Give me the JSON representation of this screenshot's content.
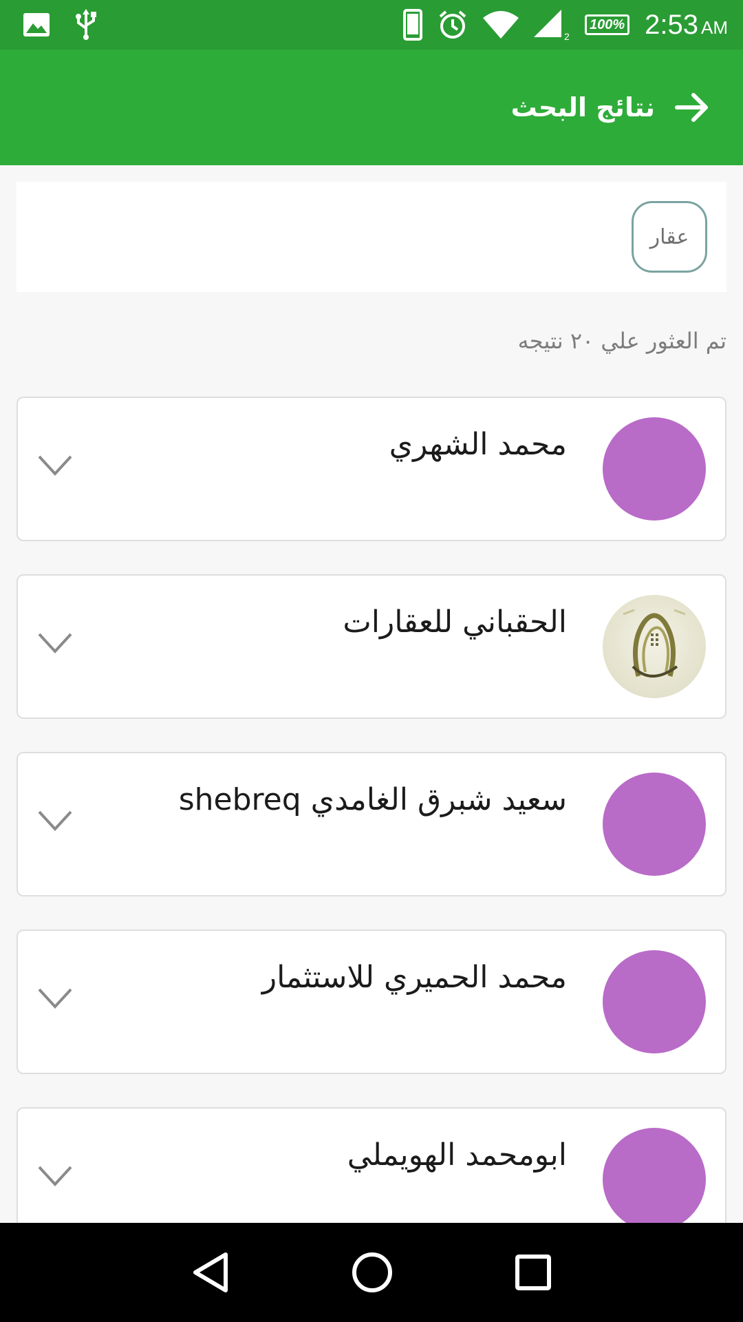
{
  "status_bar": {
    "icons_left": [
      "image-icon",
      "usb-icon"
    ],
    "icons_right": [
      "phone-icon",
      "alarm-icon",
      "wifi-icon",
      "signal-icon"
    ],
    "signal_sub": "2",
    "battery": "100%",
    "time": "2:53",
    "ampm": "AM"
  },
  "app_bar": {
    "title": "نتائج البحث",
    "back_icon": "arrow-right-icon",
    "color": "#2eac39"
  },
  "filter": {
    "chip_label": "عقار"
  },
  "results": {
    "count_text": "تم العثور علي ٢٠ نتيجه",
    "items": [
      {
        "name": "محمد الشهري",
        "avatar": "placeholder"
      },
      {
        "name": "الحقباني للعقارات",
        "avatar": "logo"
      },
      {
        "name": "سعيد شبرق الغامدي shebreq",
        "avatar": "placeholder"
      },
      {
        "name": "محمد الحميري للاستثمار",
        "avatar": "placeholder"
      },
      {
        "name": "ابومحمد الهويملي",
        "avatar": "placeholder"
      }
    ],
    "avatar_color": "#b96bc8"
  },
  "nav_bar": {
    "buttons": [
      "back-triangle-icon",
      "home-circle-icon",
      "recents-square-icon"
    ]
  }
}
